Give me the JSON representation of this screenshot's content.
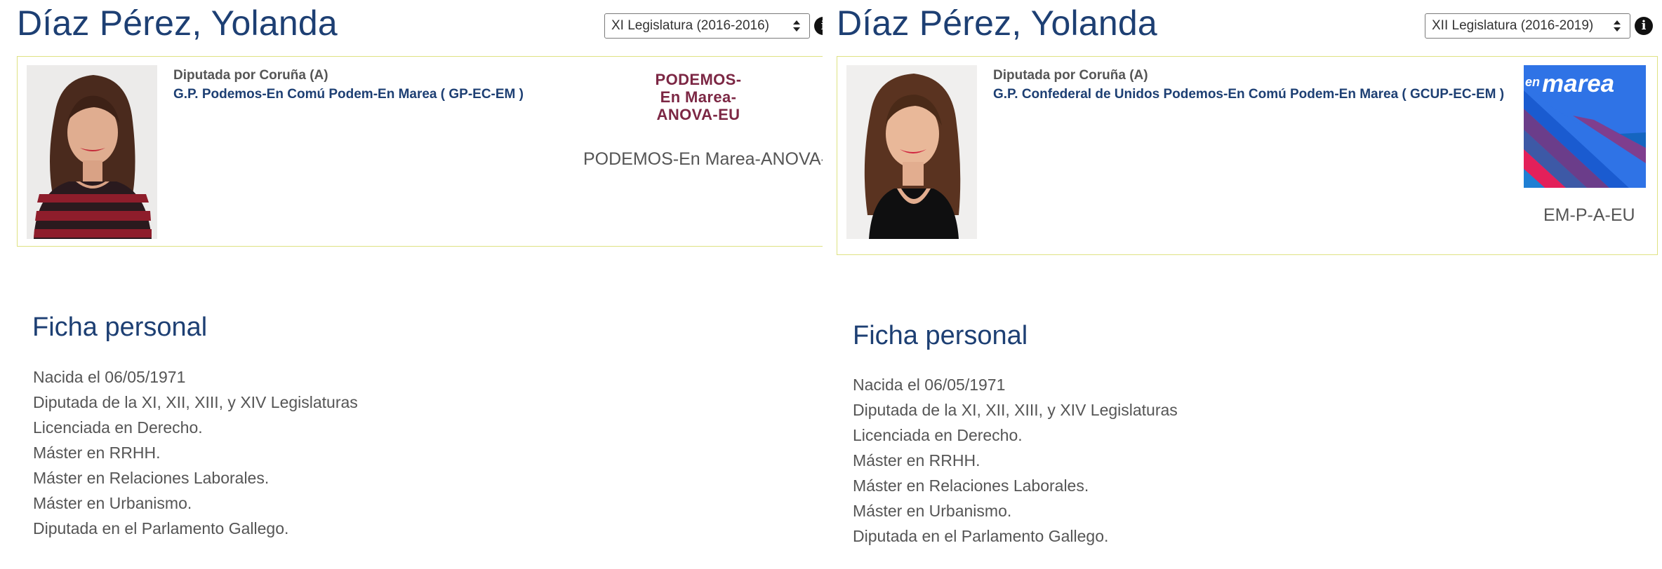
{
  "left": {
    "name": "Díaz Pérez, Yolanda",
    "legislature_selected": "XI Legislatura (2016-2016)",
    "info_icon": "info-icon",
    "district": "Diputada por Coruña (A)",
    "group": "G.P. Podemos-En Comú Podem-En Marea ( GP-EC-EM )",
    "party_logo_lines": [
      "PODEMOS-",
      "En Marea-",
      "ANOVA-EU"
    ],
    "party_name": "PODEMOS-En Marea-ANOVA-EU",
    "section_title": "Ficha personal",
    "bio": [
      "Nacida el 06/05/1971",
      "Diputada de la XI, XII, XIII, y XIV Legislaturas",
      "Licenciada en Derecho.",
      "Máster en RRHH.",
      "Máster en Relaciones Laborales.",
      "Máster en Urbanismo.",
      "Diputada en el Parlamento Gallego."
    ]
  },
  "right": {
    "name": "Díaz Pérez, Yolanda",
    "legislature_selected": "XII Legislatura (2016-2019)",
    "info_icon": "info-icon",
    "district": "Diputada por Coruña (A)",
    "group": "G.P. Confederal de Unidos Podemos-En Comú Podem-En Marea ( GCUP-EC-EM )",
    "party_logo_text": "en marea",
    "party_name": "EM-P-A-EU",
    "section_title": "Ficha personal",
    "bio": [
      "Nacida el 06/05/1971",
      "Diputada de la XI, XII, XIII, y XIV Legislaturas",
      "Licenciada en Derecho.",
      "Máster en RRHH.",
      "Máster en Relaciones Laborales.",
      "Máster en Urbanismo.",
      "Diputada en el Parlamento Gallego."
    ]
  },
  "colors": {
    "title_blue": "#1d3f73",
    "card_border": "#dfe283",
    "podemos_purple": "#7c2744",
    "enmarea_blue": "#2f73e6"
  }
}
